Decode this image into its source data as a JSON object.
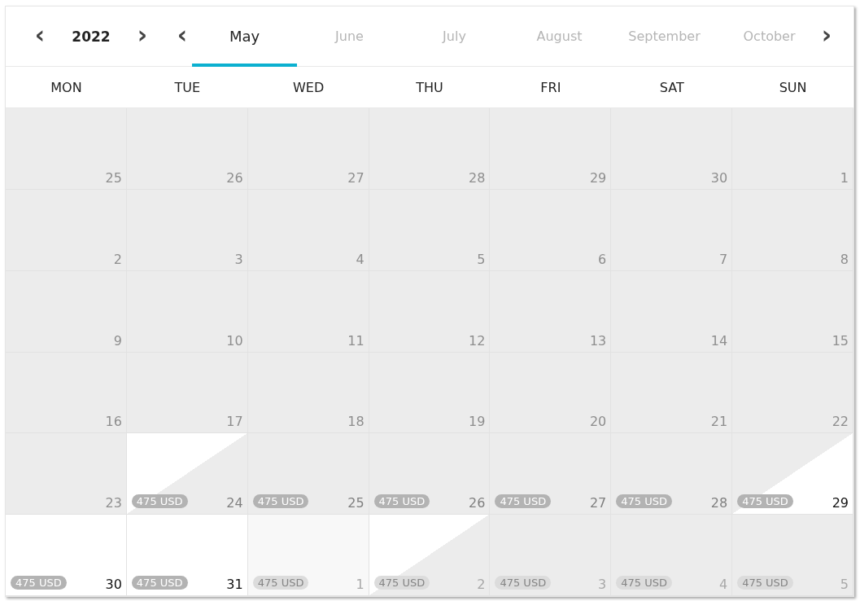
{
  "year_nav": {
    "prev": "‹",
    "year": "2022",
    "next": "›"
  },
  "month_nav": {
    "prev": "‹",
    "next": "›"
  },
  "months": [
    {
      "label": "May",
      "selected": true
    },
    {
      "label": "June",
      "selected": false
    },
    {
      "label": "July",
      "selected": false
    },
    {
      "label": "August",
      "selected": false
    },
    {
      "label": "September",
      "selected": false
    },
    {
      "label": "October",
      "selected": false
    }
  ],
  "weekdays": [
    "MON",
    "TUE",
    "WED",
    "THU",
    "FRI",
    "SAT",
    "SUN"
  ],
  "weeks": [
    [
      {
        "day": "25",
        "kind": "unavailable",
        "outside_month": false
      },
      {
        "day": "26",
        "kind": "unavailable",
        "outside_month": false
      },
      {
        "day": "27",
        "kind": "unavailable",
        "outside_month": false
      },
      {
        "day": "28",
        "kind": "unavailable",
        "outside_month": false
      },
      {
        "day": "29",
        "kind": "unavailable",
        "outside_month": false
      },
      {
        "day": "30",
        "kind": "unavailable",
        "outside_month": false
      },
      {
        "day": "1",
        "kind": "unavailable",
        "outside_month": false
      }
    ],
    [
      {
        "day": "2",
        "kind": "unavailable",
        "outside_month": false
      },
      {
        "day": "3",
        "kind": "unavailable",
        "outside_month": false
      },
      {
        "day": "4",
        "kind": "unavailable",
        "outside_month": false
      },
      {
        "day": "5",
        "kind": "unavailable",
        "outside_month": false
      },
      {
        "day": "6",
        "kind": "unavailable",
        "outside_month": false
      },
      {
        "day": "7",
        "kind": "unavailable",
        "outside_month": false
      },
      {
        "day": "8",
        "kind": "unavailable",
        "outside_month": false
      }
    ],
    [
      {
        "day": "9",
        "kind": "unavailable",
        "outside_month": false
      },
      {
        "day": "10",
        "kind": "unavailable",
        "outside_month": false
      },
      {
        "day": "11",
        "kind": "unavailable",
        "outside_month": false
      },
      {
        "day": "12",
        "kind": "unavailable",
        "outside_month": false
      },
      {
        "day": "13",
        "kind": "unavailable",
        "outside_month": false
      },
      {
        "day": "14",
        "kind": "unavailable",
        "outside_month": false
      },
      {
        "day": "15",
        "kind": "unavailable",
        "outside_month": false
      }
    ],
    [
      {
        "day": "16",
        "kind": "unavailable",
        "outside_month": false
      },
      {
        "day": "17",
        "kind": "unavailable",
        "outside_month": false
      },
      {
        "day": "18",
        "kind": "unavailable",
        "outside_month": false
      },
      {
        "day": "19",
        "kind": "unavailable",
        "outside_month": false
      },
      {
        "day": "20",
        "kind": "unavailable",
        "outside_month": false
      },
      {
        "day": "21",
        "kind": "unavailable",
        "outside_month": false
      },
      {
        "day": "22",
        "kind": "unavailable",
        "outside_month": false
      }
    ],
    [
      {
        "day": "23",
        "kind": "unavailable",
        "outside_month": false
      },
      {
        "day": "24",
        "kind": "checkout",
        "outside_month": false,
        "price": "475 USD"
      },
      {
        "day": "25",
        "kind": "unavailable",
        "outside_month": false,
        "price": "475 USD"
      },
      {
        "day": "26",
        "kind": "unavailable",
        "outside_month": false,
        "price": "475 USD"
      },
      {
        "day": "27",
        "kind": "unavailable",
        "outside_month": false,
        "price": "475 USD"
      },
      {
        "day": "28",
        "kind": "unavailable",
        "outside_month": false,
        "price": "475 USD"
      },
      {
        "day": "29",
        "kind": "checkin",
        "outside_month": false,
        "price": "475 USD"
      }
    ],
    [
      {
        "day": "30",
        "kind": "available",
        "outside_month": false,
        "price": "475 USD"
      },
      {
        "day": "31",
        "kind": "available",
        "outside_month": false,
        "price": "475 USD"
      },
      {
        "day": "1",
        "kind": "available",
        "outside_month": true,
        "price": "475 USD"
      },
      {
        "day": "2",
        "kind": "checkout",
        "outside_month": true,
        "price": "475 USD"
      },
      {
        "day": "3",
        "kind": "unavailable",
        "outside_month": true,
        "price": "475 USD"
      },
      {
        "day": "4",
        "kind": "unavailable",
        "outside_month": true,
        "price": "475 USD"
      },
      {
        "day": "5",
        "kind": "unavailable",
        "outside_month": true,
        "price": "475 USD"
      }
    ]
  ]
}
